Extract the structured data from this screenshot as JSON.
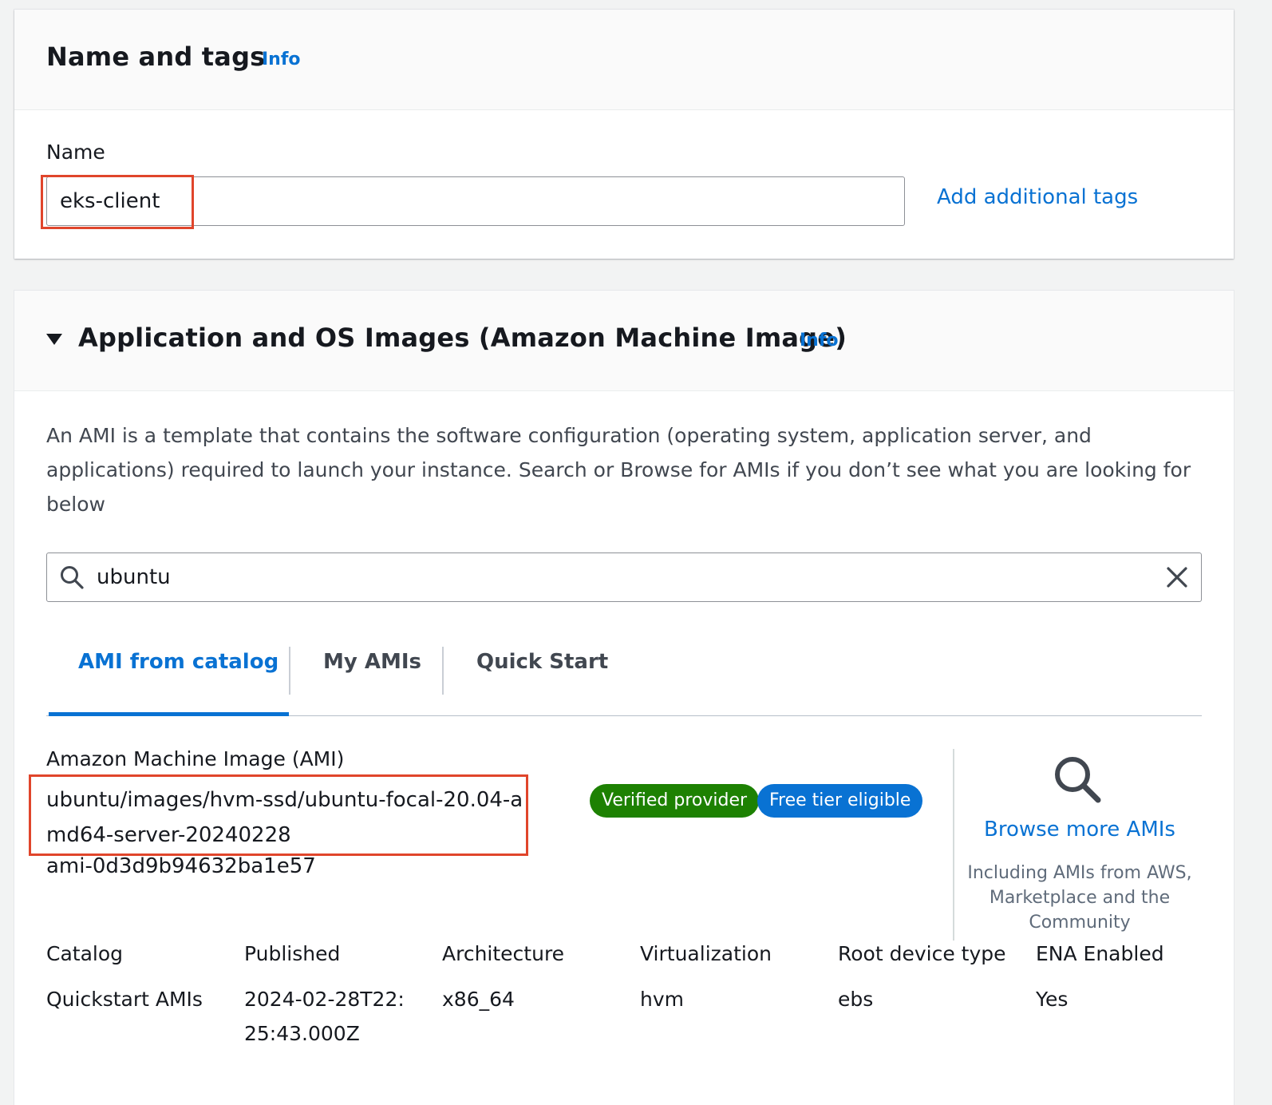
{
  "name_tags": {
    "title": "Name and tags",
    "info": "Info",
    "name_label": "Name",
    "name_value": "eks-client",
    "add_tags": "Add additional tags"
  },
  "ami_section": {
    "title": "Application and OS Images (Amazon Machine Image)",
    "info": "Info",
    "description": "An AMI is a template that contains the software configuration (operating system, application server, and applications) required to launch your instance. Search or Browse for AMIs if you don’t see what you are looking for below",
    "search_value": "ubuntu",
    "tabs": [
      {
        "label": "AMI from catalog",
        "active": true
      },
      {
        "label": "My AMIs",
        "active": false
      },
      {
        "label": "Quick Start",
        "active": false
      }
    ],
    "ami_label": "Amazon Machine Image (AMI)",
    "ami_name": "ubuntu/images/hvm-ssd/ubuntu-focal-20.04-amd64-server-20240228",
    "ami_id": "ami-0d3d9b94632ba1e57",
    "badges": {
      "verified": "Verified provider",
      "free_tier": "Free tier eligible"
    },
    "browse": {
      "link": "Browse more AMIs",
      "description": "Including AMIs from AWS, Marketplace and the Community"
    },
    "details": {
      "headers": [
        "Catalog",
        "Published",
        "Architecture",
        "Virtualization",
        "Root device type",
        "ENA Enabled"
      ],
      "values": [
        "Quickstart AMIs",
        "2024-02-28T22:25:43.000Z",
        "x86_64",
        "hvm",
        "ebs",
        "Yes"
      ]
    }
  },
  "colors": {
    "link": "#0972d3",
    "highlight": "#e0452b",
    "verified_badge": "#1d8102",
    "free_badge": "#0972d3"
  },
  "icons": {
    "search": "search-icon",
    "clear": "close-icon",
    "browse": "magnifier-icon",
    "collapse": "caret-down-icon"
  }
}
